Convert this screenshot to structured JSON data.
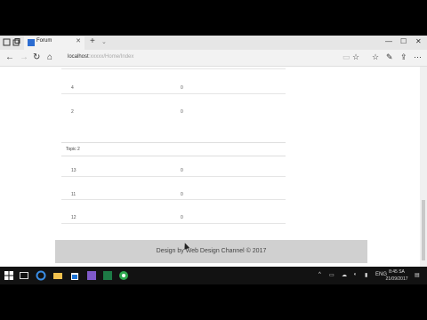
{
  "browser": {
    "tab_title": "Forum",
    "tab_close": "✕",
    "new_tab": "+",
    "tab_menu": "⌄",
    "url_host": "localhost",
    "url_path": ":xxxxx/Home/Index",
    "back": "←",
    "forward": "→",
    "refresh": "↻",
    "home": "⌂",
    "minimize": "—",
    "maximize": "☐",
    "close": "✕"
  },
  "forum": {
    "first_rows": [
      {
        "id": "4",
        "count": "0"
      },
      {
        "id": "2",
        "count": "0"
      }
    ],
    "topic2_title": "Topic 2",
    "topic2_rows": [
      {
        "id": "13",
        "count": "0"
      },
      {
        "id": "11",
        "count": "0"
      },
      {
        "id": "12",
        "count": "0"
      }
    ],
    "footer": "Design by Web Design Channel © 2017"
  },
  "taskbar": {
    "language": "ENG",
    "time": "8:45 SA",
    "date": "21/09/2017"
  },
  "colors": {
    "accent": "#2b6cd1",
    "footer_bg": "#d0d0d0",
    "taskbar_bg": "#121212"
  }
}
